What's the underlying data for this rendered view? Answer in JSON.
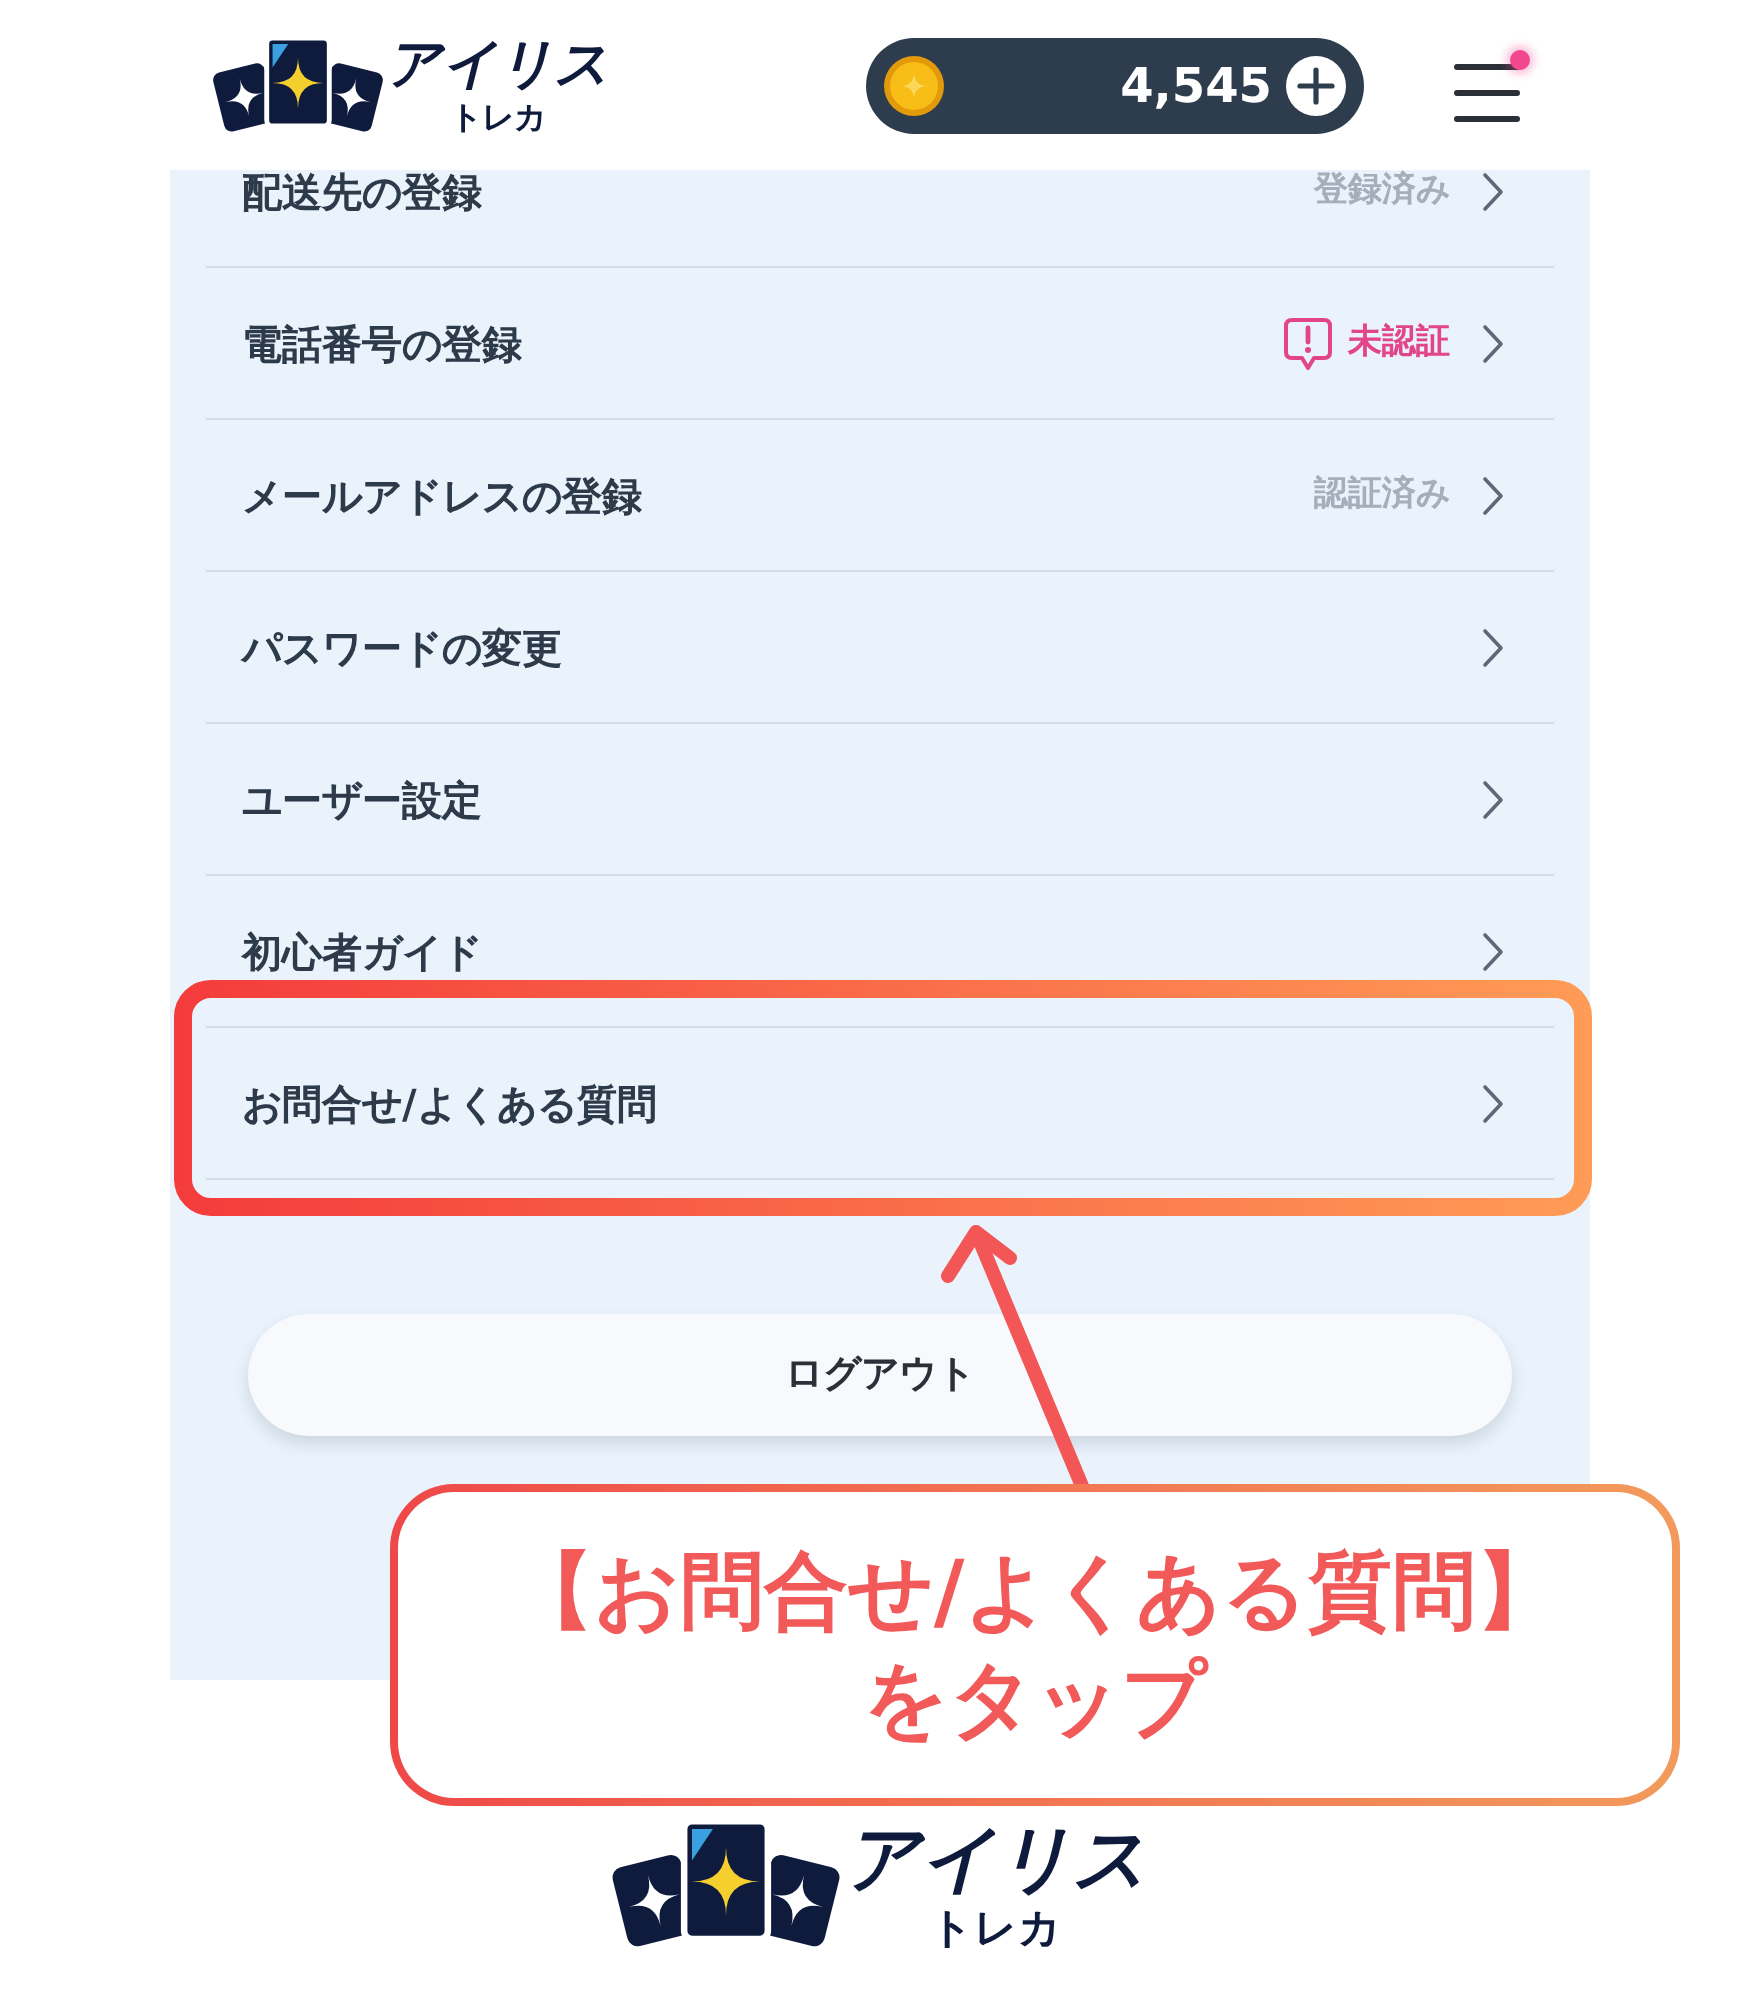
{
  "header": {
    "logo": {
      "title": "アイリス",
      "subtitle": "トレカ"
    },
    "coins": {
      "balance": "4,545"
    },
    "menu": {
      "notification": true
    }
  },
  "menu_items": [
    {
      "label": "配送先の登録",
      "highlighted": false,
      "status": {
        "kind": "done",
        "text": "登録済み"
      }
    },
    {
      "label": "電話番号の登録",
      "highlighted": false,
      "status": {
        "kind": "unverified",
        "text": "未認証"
      }
    },
    {
      "label": "メールアドレスの登録",
      "highlighted": false,
      "status": {
        "kind": "done",
        "text": "認証済み"
      }
    },
    {
      "label": "パスワードの変更",
      "highlighted": false
    },
    {
      "label": "ユーザー設定",
      "highlighted": false
    },
    {
      "label": "初心者ガイド",
      "highlighted": false
    },
    {
      "label": "お問合せ/よくある質問",
      "highlighted": true
    }
  ],
  "logout_button": "ログアウト",
  "footer_logo": {
    "title": "アイリス",
    "subtitle": "トレカ"
  },
  "callout": {
    "lines": [
      "【お問合せ/よくある質問】",
      "をタップ"
    ]
  }
}
